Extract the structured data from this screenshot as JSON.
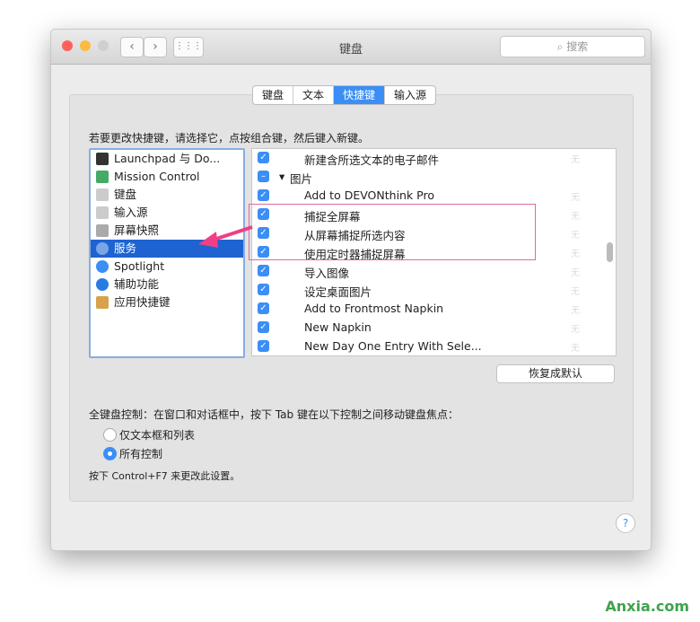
{
  "window": {
    "title": "键盘",
    "search_placeholder": "搜索"
  },
  "tabs": [
    {
      "label": "键盘"
    },
    {
      "label": "文本"
    },
    {
      "label": "快捷键",
      "active": true
    },
    {
      "label": "输入源"
    }
  ],
  "instruction": "若要更改快捷键，请选择它，点按组合键，然后键入新键。",
  "categories": [
    {
      "label": "Launchpad 与 Do...",
      "icon": "launchpad-icon"
    },
    {
      "label": "Mission Control",
      "icon": "mission-control-icon"
    },
    {
      "label": "键盘",
      "icon": "keyboard-icon"
    },
    {
      "label": "输入源",
      "icon": "keyboard-icon"
    },
    {
      "label": "屏幕快照",
      "icon": "screenshot-icon"
    },
    {
      "label": "服务",
      "icon": "gear-icon",
      "selected": true
    },
    {
      "label": "Spotlight",
      "icon": "spotlight-icon"
    },
    {
      "label": "辅助功能",
      "icon": "accessibility-icon"
    },
    {
      "label": "应用快捷键",
      "icon": "app-shortcuts-icon"
    }
  ],
  "shortcuts": [
    {
      "label": "新建含所选文本的电子邮件",
      "checked": true,
      "shortcut": "无"
    },
    {
      "label": "图片",
      "group": true,
      "checked": "mixed"
    },
    {
      "label": "Add to DEVONthink Pro",
      "checked": true,
      "shortcut": "无"
    },
    {
      "label": "捕捉全屏幕",
      "checked": true,
      "shortcut": "无"
    },
    {
      "label": "从屏幕捕捉所选内容",
      "checked": true,
      "shortcut": "无"
    },
    {
      "label": "使用定时器捕捉屏幕",
      "checked": true,
      "shortcut": "无"
    },
    {
      "label": "导入图像",
      "checked": true,
      "shortcut": "无"
    },
    {
      "label": "设定桌面图片",
      "checked": true,
      "shortcut": "无"
    },
    {
      "label": "Add to Frontmost Napkin",
      "checked": true,
      "shortcut": "无"
    },
    {
      "label": "New Napkin",
      "checked": true,
      "shortcut": "无"
    },
    {
      "label": "New Day One Entry With Sele...",
      "checked": true,
      "shortcut": "无"
    }
  ],
  "restore_defaults": "恢复成默认",
  "full_keyboard": {
    "label": "全键盘控制：在窗口和对话框中，按下 Tab 键在以下控制之间移动键盘焦点：",
    "options": [
      {
        "label": "仅文本框和列表",
        "selected": false
      },
      {
        "label": "所有控制",
        "selected": true
      }
    ],
    "note": "按下 Control+F7 来更改此设置。"
  },
  "help": "?",
  "watermark": "Anxia.com",
  "colors": {
    "accent": "#3a8ef5",
    "selection": "#1e63d1",
    "highlight_box": "#e06aa0",
    "arrow": "#ee3f87"
  }
}
